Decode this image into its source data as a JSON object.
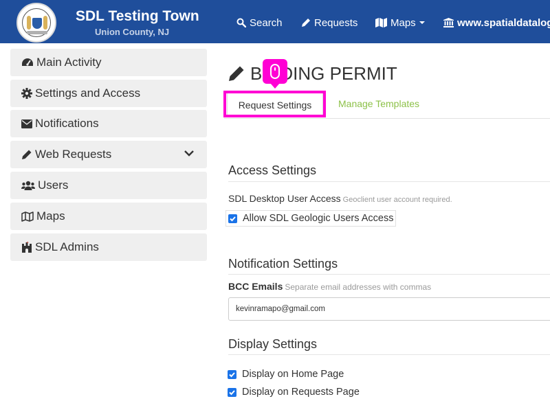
{
  "header": {
    "town_name": "SDL Testing Town",
    "county": "Union County, NJ",
    "nav": {
      "search": "Search",
      "requests": "Requests",
      "maps": "Maps",
      "site": "www.spatialdatalogic"
    },
    "icons": [
      "seal-logo",
      "search-icon",
      "pencil-icon",
      "map-icon",
      "caret-down-icon",
      "institution-icon"
    ],
    "bar_color": "#1f4e9b"
  },
  "sidebar": {
    "items": [
      {
        "label": "Main Activity",
        "icon": "dashboard-icon"
      },
      {
        "label": "Settings and Access",
        "icon": "gear-icon"
      },
      {
        "label": "Notifications",
        "icon": "envelope-icon"
      },
      {
        "label": "Web Requests",
        "icon": "pencil-icon"
      },
      {
        "label": "Users",
        "icon": "users-icon"
      },
      {
        "label": "Maps",
        "icon": "map-outline-icon"
      },
      {
        "label": "SDL Admins",
        "icon": "castle-icon"
      }
    ]
  },
  "main": {
    "title_prefix": "B",
    "title_suffix": "DING PERMIT",
    "tabs": {
      "active": "Request Settings",
      "other": "Manage Templates"
    },
    "access": {
      "heading": "Access Settings",
      "desktop_label": "SDL Desktop User Access",
      "desktop_hint": "Geoclient user account required.",
      "allow_label": "Allow SDL Geologic Users Access",
      "allow_checked": true
    },
    "notification": {
      "heading": "Notification Settings",
      "bcc_label": "BCC Emails",
      "bcc_hint": "Separate email addresses with commas",
      "bcc_value": "kevinramapo@gmail.com"
    },
    "display": {
      "heading": "Display Settings",
      "home_label": "Display on Home Page",
      "home_checked": true,
      "requests_label": "Display on Requests Page",
      "requests_checked": true
    }
  },
  "colors": {
    "highlight": "#ff00d4",
    "link_green": "#8dc149",
    "checkbox_blue": "#1a73e8"
  }
}
